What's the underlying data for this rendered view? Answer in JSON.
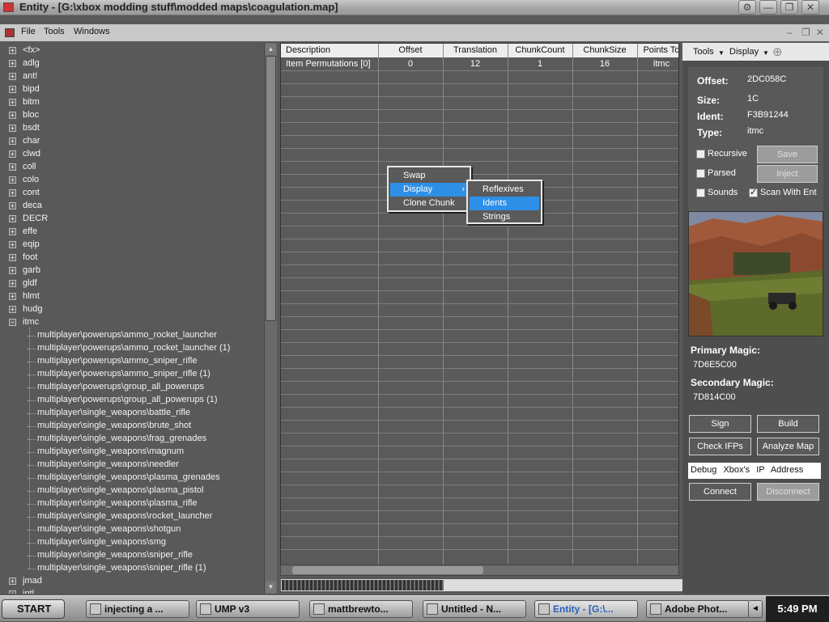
{
  "window": {
    "title": "Entity - [G:\\xbox modding stuff\\modded maps\\coagulation.map]"
  },
  "menubar": {
    "items": [
      "File",
      "Tools",
      "Windows"
    ]
  },
  "tree": {
    "tags": [
      "<fx>",
      "adlg",
      "ant!",
      "bipd",
      "bitm",
      "bloc",
      "bsdt",
      "char",
      "clwd",
      "coll",
      "colo",
      "cont",
      "deca",
      "DECR",
      "effe",
      "eqip",
      "foot",
      "garb",
      "gldf",
      "hlmt",
      "hudg",
      "itmc"
    ],
    "itmc_children": [
      "multiplayer\\powerups\\ammo_rocket_launcher",
      "multiplayer\\powerups\\ammo_rocket_launcher (1)",
      "multiplayer\\powerups\\ammo_sniper_rifle",
      "multiplayer\\powerups\\ammo_sniper_rifle (1)",
      "multiplayer\\powerups\\group_all_powerups",
      "multiplayer\\powerups\\group_all_powerups (1)",
      "multiplayer\\single_weapons\\battle_rifle",
      "multiplayer\\single_weapons\\brute_shot",
      "multiplayer\\single_weapons\\frag_grenades",
      "multiplayer\\single_weapons\\magnum",
      "multiplayer\\single_weapons\\needler",
      "multiplayer\\single_weapons\\plasma_grenades",
      "multiplayer\\single_weapons\\plasma_pistol",
      "multiplayer\\single_weapons\\plasma_rifle",
      "multiplayer\\single_weapons\\rocket_launcher",
      "multiplayer\\single_weapons\\shotgun",
      "multiplayer\\single_weapons\\smg",
      "multiplayer\\single_weapons\\sniper_rifle",
      "multiplayer\\single_weapons\\sniper_rifle (1)"
    ],
    "after": [
      "jmad",
      "jptl"
    ]
  },
  "grid": {
    "columns": [
      "Description",
      "Offset",
      "Translation",
      "ChunkCount",
      "ChunkSize",
      "Points To"
    ],
    "rows": [
      [
        "Item Permutations [0]",
        "0",
        "12",
        "1",
        "16",
        "itmc"
      ]
    ]
  },
  "context_menu": {
    "items": [
      "Swap",
      "Display",
      "Clone Chunk"
    ],
    "submenu": [
      "Reflexives",
      "Idents",
      "Strings"
    ],
    "selected_submenu": "Idents"
  },
  "right_panel": {
    "toolbar": {
      "tools": "Tools",
      "display": "Display"
    },
    "labels": {
      "offset": "Offset:",
      "size": "Size:",
      "ident": "Ident:",
      "type": "Type:"
    },
    "values": {
      "offset": "2DC058C",
      "size": "1C",
      "ident": "F3B91244",
      "type": "itmc"
    },
    "checkboxes": {
      "recursive": "Recursive",
      "parsed": "Parsed",
      "sounds": "Sounds",
      "scan": "Scan With Ent"
    },
    "scan_checked": true,
    "buttons": {
      "save": "Save",
      "inject": "Inject",
      "sign": "Sign",
      "build": "Build",
      "check_ifps": "Check IFPs",
      "analyze_map": "Analyze Map",
      "connect": "Connect",
      "disconnect": "Disconnect"
    },
    "primary_magic_label": "Primary Magic:",
    "primary_magic": "7D6E5C00",
    "secondary_magic_label": "Secondary Magic:",
    "secondary_magic": "7D814C00",
    "ip_field": "Debug Xbox's IP Address"
  },
  "taskbar": {
    "start": "START",
    "tasks": [
      "injecting a ...",
      "UMP v3",
      "mattbrewto...",
      "Untitled - N...",
      "Entity - [G:\\...",
      "Adobe Phot..."
    ],
    "clock": "5:49 PM"
  }
}
